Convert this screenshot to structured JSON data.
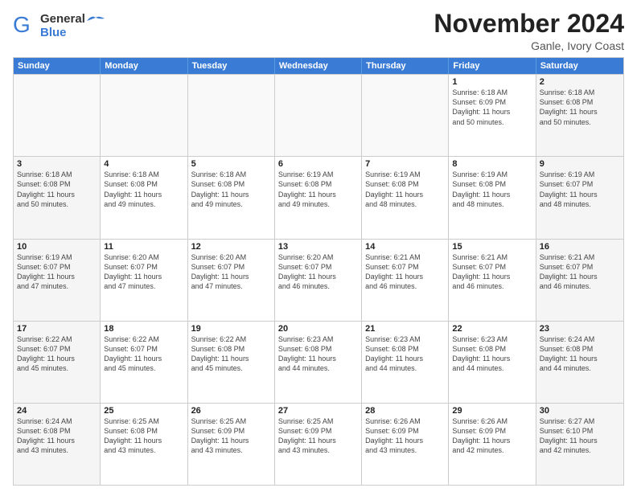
{
  "logo": {
    "line1": "General",
    "line2": "Blue"
  },
  "title": "November 2024",
  "subtitle": "Ganle, Ivory Coast",
  "header_days": [
    "Sunday",
    "Monday",
    "Tuesday",
    "Wednesday",
    "Thursday",
    "Friday",
    "Saturday"
  ],
  "weeks": [
    [
      {
        "day": "",
        "info": "",
        "empty": true
      },
      {
        "day": "",
        "info": "",
        "empty": true
      },
      {
        "day": "",
        "info": "",
        "empty": true
      },
      {
        "day": "",
        "info": "",
        "empty": true
      },
      {
        "day": "",
        "info": "",
        "empty": true
      },
      {
        "day": "1",
        "info": "Sunrise: 6:18 AM\nSunset: 6:09 PM\nDaylight: 11 hours\nand 50 minutes.",
        "empty": false
      },
      {
        "day": "2",
        "info": "Sunrise: 6:18 AM\nSunset: 6:08 PM\nDaylight: 11 hours\nand 50 minutes.",
        "empty": false,
        "shaded": true
      }
    ],
    [
      {
        "day": "3",
        "info": "Sunrise: 6:18 AM\nSunset: 6:08 PM\nDaylight: 11 hours\nand 50 minutes.",
        "empty": false,
        "shaded": true
      },
      {
        "day": "4",
        "info": "Sunrise: 6:18 AM\nSunset: 6:08 PM\nDaylight: 11 hours\nand 49 minutes.",
        "empty": false
      },
      {
        "day": "5",
        "info": "Sunrise: 6:18 AM\nSunset: 6:08 PM\nDaylight: 11 hours\nand 49 minutes.",
        "empty": false
      },
      {
        "day": "6",
        "info": "Sunrise: 6:19 AM\nSunset: 6:08 PM\nDaylight: 11 hours\nand 49 minutes.",
        "empty": false
      },
      {
        "day": "7",
        "info": "Sunrise: 6:19 AM\nSunset: 6:08 PM\nDaylight: 11 hours\nand 48 minutes.",
        "empty": false
      },
      {
        "day": "8",
        "info": "Sunrise: 6:19 AM\nSunset: 6:08 PM\nDaylight: 11 hours\nand 48 minutes.",
        "empty": false
      },
      {
        "day": "9",
        "info": "Sunrise: 6:19 AM\nSunset: 6:07 PM\nDaylight: 11 hours\nand 48 minutes.",
        "empty": false,
        "shaded": true
      }
    ],
    [
      {
        "day": "10",
        "info": "Sunrise: 6:19 AM\nSunset: 6:07 PM\nDaylight: 11 hours\nand 47 minutes.",
        "empty": false,
        "shaded": true
      },
      {
        "day": "11",
        "info": "Sunrise: 6:20 AM\nSunset: 6:07 PM\nDaylight: 11 hours\nand 47 minutes.",
        "empty": false
      },
      {
        "day": "12",
        "info": "Sunrise: 6:20 AM\nSunset: 6:07 PM\nDaylight: 11 hours\nand 47 minutes.",
        "empty": false
      },
      {
        "day": "13",
        "info": "Sunrise: 6:20 AM\nSunset: 6:07 PM\nDaylight: 11 hours\nand 46 minutes.",
        "empty": false
      },
      {
        "day": "14",
        "info": "Sunrise: 6:21 AM\nSunset: 6:07 PM\nDaylight: 11 hours\nand 46 minutes.",
        "empty": false
      },
      {
        "day": "15",
        "info": "Sunrise: 6:21 AM\nSunset: 6:07 PM\nDaylight: 11 hours\nand 46 minutes.",
        "empty": false
      },
      {
        "day": "16",
        "info": "Sunrise: 6:21 AM\nSunset: 6:07 PM\nDaylight: 11 hours\nand 46 minutes.",
        "empty": false,
        "shaded": true
      }
    ],
    [
      {
        "day": "17",
        "info": "Sunrise: 6:22 AM\nSunset: 6:07 PM\nDaylight: 11 hours\nand 45 minutes.",
        "empty": false,
        "shaded": true
      },
      {
        "day": "18",
        "info": "Sunrise: 6:22 AM\nSunset: 6:07 PM\nDaylight: 11 hours\nand 45 minutes.",
        "empty": false
      },
      {
        "day": "19",
        "info": "Sunrise: 6:22 AM\nSunset: 6:08 PM\nDaylight: 11 hours\nand 45 minutes.",
        "empty": false
      },
      {
        "day": "20",
        "info": "Sunrise: 6:23 AM\nSunset: 6:08 PM\nDaylight: 11 hours\nand 44 minutes.",
        "empty": false
      },
      {
        "day": "21",
        "info": "Sunrise: 6:23 AM\nSunset: 6:08 PM\nDaylight: 11 hours\nand 44 minutes.",
        "empty": false
      },
      {
        "day": "22",
        "info": "Sunrise: 6:23 AM\nSunset: 6:08 PM\nDaylight: 11 hours\nand 44 minutes.",
        "empty": false
      },
      {
        "day": "23",
        "info": "Sunrise: 6:24 AM\nSunset: 6:08 PM\nDaylight: 11 hours\nand 44 minutes.",
        "empty": false,
        "shaded": true
      }
    ],
    [
      {
        "day": "24",
        "info": "Sunrise: 6:24 AM\nSunset: 6:08 PM\nDaylight: 11 hours\nand 43 minutes.",
        "empty": false,
        "shaded": true
      },
      {
        "day": "25",
        "info": "Sunrise: 6:25 AM\nSunset: 6:08 PM\nDaylight: 11 hours\nand 43 minutes.",
        "empty": false
      },
      {
        "day": "26",
        "info": "Sunrise: 6:25 AM\nSunset: 6:09 PM\nDaylight: 11 hours\nand 43 minutes.",
        "empty": false
      },
      {
        "day": "27",
        "info": "Sunrise: 6:25 AM\nSunset: 6:09 PM\nDaylight: 11 hours\nand 43 minutes.",
        "empty": false
      },
      {
        "day": "28",
        "info": "Sunrise: 6:26 AM\nSunset: 6:09 PM\nDaylight: 11 hours\nand 43 minutes.",
        "empty": false
      },
      {
        "day": "29",
        "info": "Sunrise: 6:26 AM\nSunset: 6:09 PM\nDaylight: 11 hours\nand 42 minutes.",
        "empty": false
      },
      {
        "day": "30",
        "info": "Sunrise: 6:27 AM\nSunset: 6:10 PM\nDaylight: 11 hours\nand 42 minutes.",
        "empty": false,
        "shaded": true
      }
    ]
  ]
}
